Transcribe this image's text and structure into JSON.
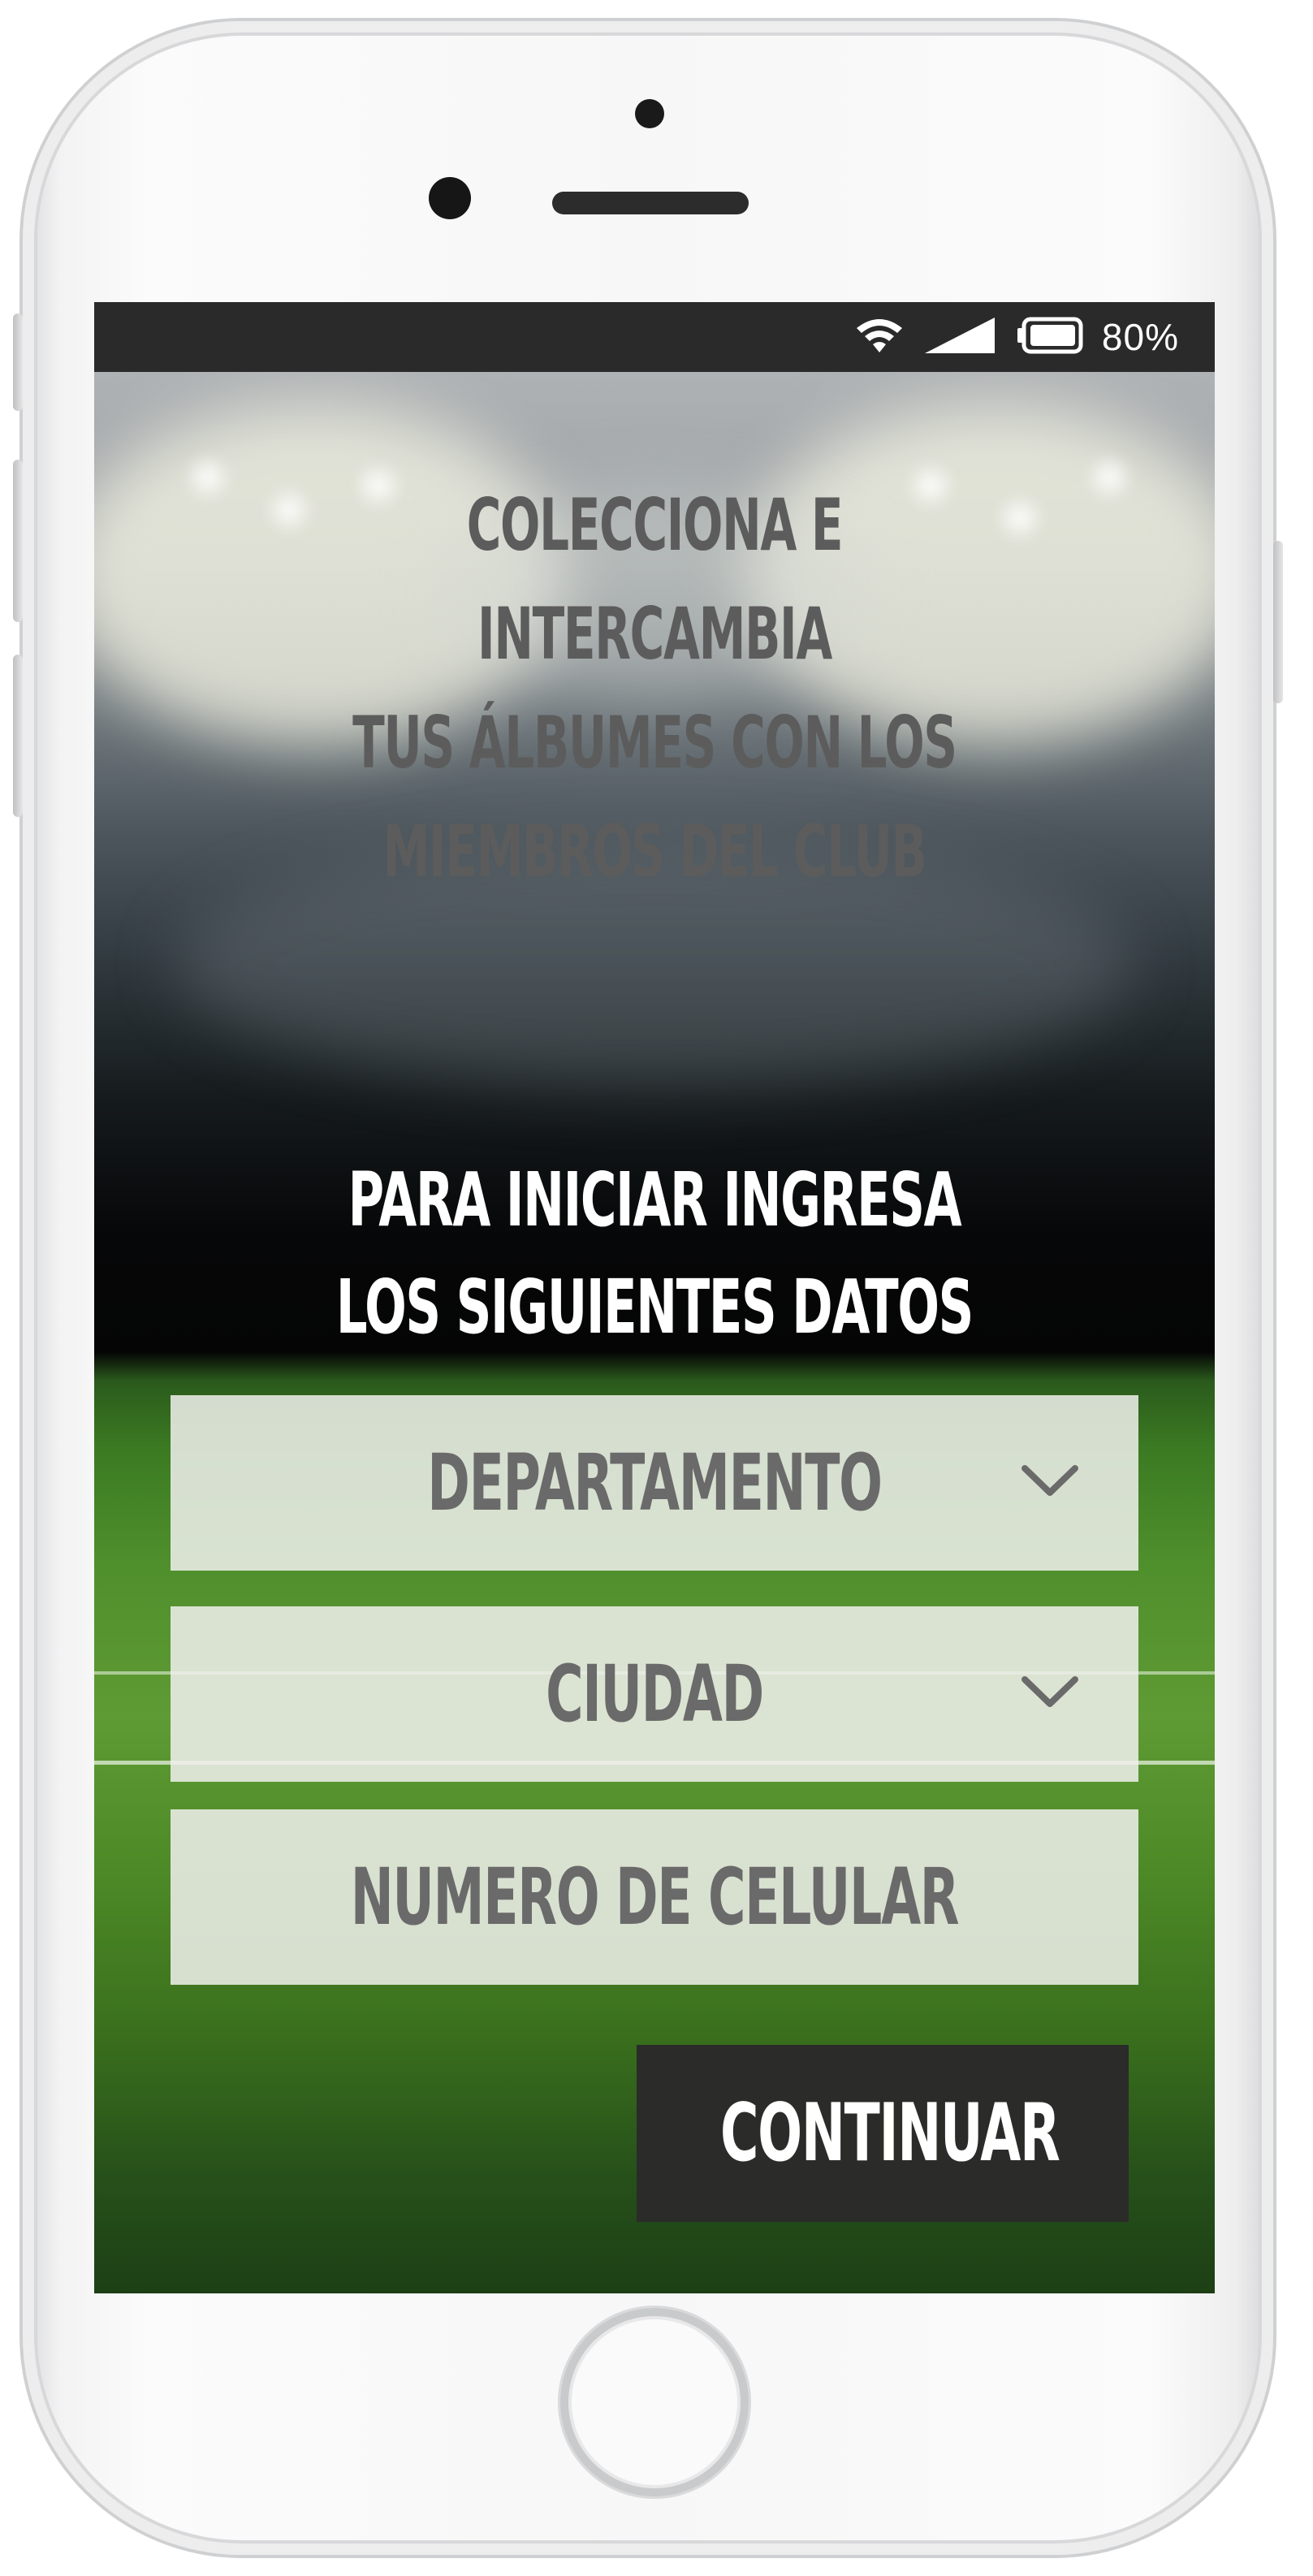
{
  "status_bar": {
    "wifi_icon": "wifi-icon",
    "signal_icon": "signal-icon",
    "battery_icon": "battery-icon",
    "battery_percent": "80%"
  },
  "intro": {
    "lines": [
      "COLECCIONA E INTERCAMBIA",
      "TUS ÁLBUMES CON LOS",
      "MIEMBROS DEL CLUB"
    ]
  },
  "prompt": {
    "lines": [
      "PARA INICIAR INGRESA",
      "LOS SIGUIENTES DATOS"
    ]
  },
  "form": {
    "department": {
      "label": "DEPARTAMENTO",
      "icon": "chevron-down-icon"
    },
    "city": {
      "label": "CIUDAD",
      "icon": "chevron-down-icon"
    },
    "phone": {
      "placeholder": "NUMERO DE CELULAR"
    },
    "continue_label": "CONTINUAR"
  },
  "colors": {
    "status_bar_bg": "#2a2a2b",
    "field_bg": "#f0f0ec",
    "field_text": "#6a6a6a",
    "intro_text": "#5c5c5c",
    "prompt_text": "#ffffff",
    "button_bg": "#2b2b2a",
    "button_text": "#ffffff"
  }
}
